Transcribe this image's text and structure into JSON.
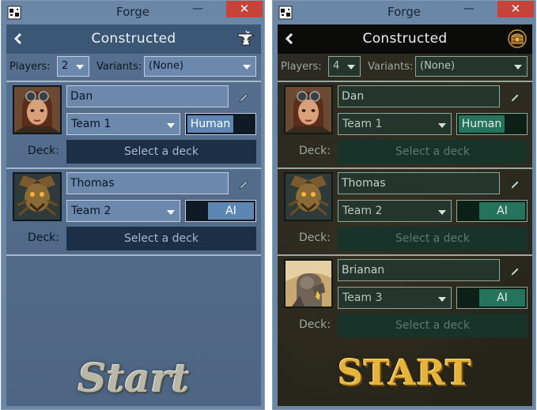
{
  "windows": [
    {
      "title": "Forge",
      "close": "✕",
      "minimize": "—",
      "header": {
        "title": "Constructed"
      },
      "players_label": "Players:",
      "players_value": "2",
      "variants_label": "Variants:",
      "variants_value": "(None)",
      "players": [
        {
          "name": "Dan",
          "team": "Team 1",
          "type": "Human",
          "deck_label": "Deck:",
          "deck": "Select a deck"
        },
        {
          "name": "Thomas",
          "team": "Team 2",
          "type": "AI",
          "deck_label": "Deck:",
          "deck": "Select a deck"
        }
      ],
      "start": "Start"
    },
    {
      "title": "Forge",
      "close": "✕",
      "minimize": "—",
      "header": {
        "title": "Constructed"
      },
      "players_label": "Players:",
      "players_value": "4",
      "variants_label": "Variants:",
      "variants_value": "(None)",
      "players": [
        {
          "name": "Dan",
          "team": "Team 1",
          "type": "Human",
          "deck_label": "Deck:",
          "deck": "Select a deck"
        },
        {
          "name": "Thomas",
          "team": "Team 2",
          "type": "AI",
          "deck_label": "Deck:",
          "deck": "Select a deck"
        },
        {
          "name": "Brianan",
          "team": "Team 3",
          "type": "AI",
          "deck_label": "Deck:",
          "deck": "Select a deck"
        }
      ],
      "start": "START"
    }
  ],
  "icons": {
    "back": "chevron-left-icon",
    "anvil": "anvil-icon",
    "chest": "treasure-chest-icon",
    "edit": "pencil-icon",
    "app": "forge-app-icon"
  }
}
